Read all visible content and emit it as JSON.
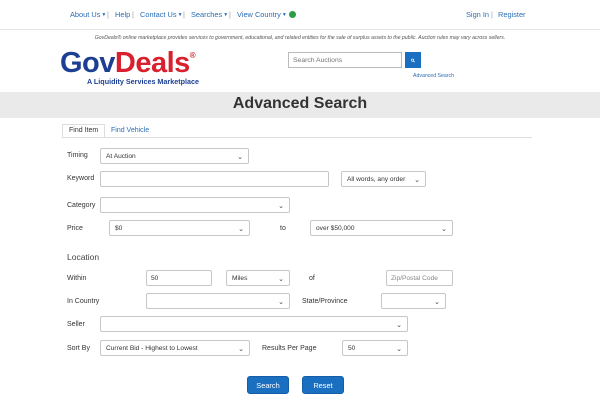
{
  "topnav": {
    "about_us": "About Us",
    "help": "Help",
    "contact_us": "Contact Us",
    "searches": "Searches",
    "view_country": "View Country",
    "sign_in": "Sign In",
    "register": "Register",
    "separator": "|"
  },
  "tagline": "GovDeals® online marketplace provides services to government, educational, and related entities for the sale of surplus assets to the public. Auction rules may vary across sellers.",
  "logo": {
    "gov": "Gov",
    "deals": "Deals",
    "reg": "®",
    "subtitle": "A Liquidity Services Marketplace"
  },
  "search": {
    "placeholder": "Search Auctions",
    "advanced_link": "Advanced Search"
  },
  "page_title": "Advanced Search",
  "tabs": [
    {
      "label": "Find Item",
      "active": true
    },
    {
      "label": "Find Vehicle",
      "active": false
    }
  ],
  "form": {
    "timing_label": "Timing",
    "timing_value": "At Auction",
    "keyword_label": "Keyword",
    "keyword_value": "",
    "keyword_mode": "All words, any order",
    "category_label": "Category",
    "category_value": "",
    "price_label": "Price",
    "price_min": "$0",
    "price_to": "to",
    "price_max": "over $50,000",
    "location_header": "Location",
    "within_label": "Within",
    "within_value": "50",
    "distance_unit": "Miles",
    "of_label": "of",
    "zip_placeholder": "Zip/Postal Code",
    "country_label": "In Country",
    "country_value": "",
    "state_label": "State/Province",
    "state_value": "",
    "seller_label": "Seller",
    "seller_value": "",
    "sort_label": "Sort By",
    "sort_value": "Current Bid - Highest to Lowest",
    "rpp_label": "Results Per Page",
    "rpp_value": "50"
  },
  "buttons": {
    "search": "Search",
    "reset": "Reset"
  },
  "colors": {
    "accent": "#1b6fc1",
    "link": "#2a6db5",
    "logo_blue": "#1c3f94",
    "logo_red": "#d9202e",
    "band": "#eaeaea"
  }
}
